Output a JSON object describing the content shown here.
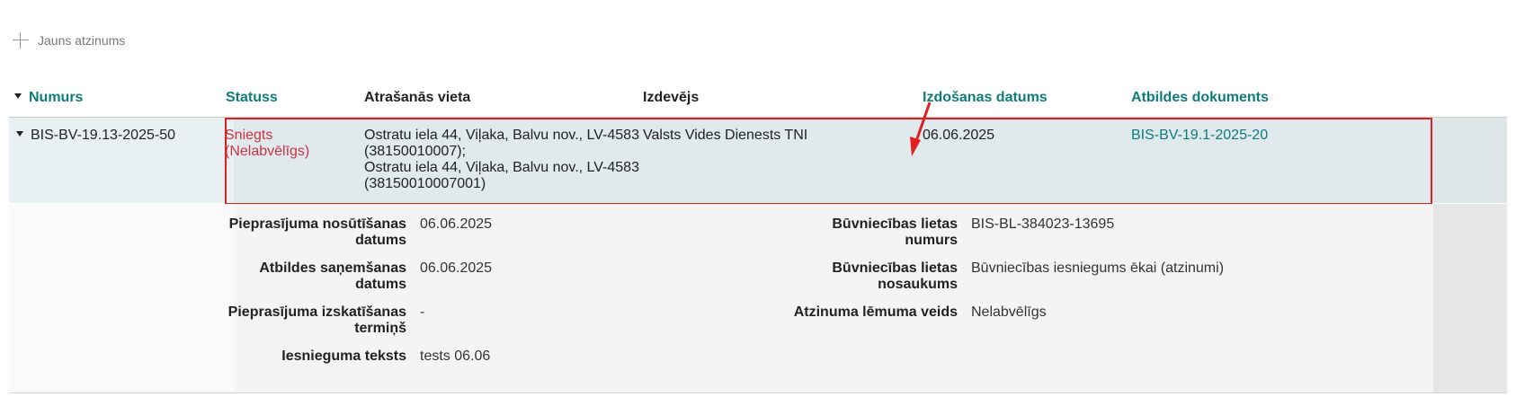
{
  "toolbar": {
    "new_label": "Jauns atzinums"
  },
  "table": {
    "columns": {
      "number": "Numurs",
      "status": "Statuss",
      "location": "Atrašanās vieta",
      "issuer": "Izdevējs",
      "issue_date": "Izdošanas datums",
      "response_doc": "Atbildes dokuments"
    },
    "row": {
      "number": "BIS-BV-19.13-2025-50",
      "status_line1": "Sniegts",
      "status_line2": "(Nelabvēlīgs)",
      "location_lines": [
        "Ostratu iela 44, Viļaka, Balvu nov., LV-4583",
        "(38150010007);",
        "Ostratu iela 44, Viļaka, Balvu nov., LV-4583",
        "(38150010007001)"
      ],
      "issuer": "Valsts Vides Dienests TNI",
      "issue_date": "06.06.2025",
      "response_doc": "BIS-BV-19.1-2025-20"
    }
  },
  "details": {
    "request_sent_label_1": "Pieprasījuma nosūtīšanas",
    "request_sent_label_2": "datums",
    "request_sent_value": "06.06.2025",
    "response_received_label_1": "Atbildes saņemšanas",
    "response_received_label_2": "datums",
    "response_received_value": "06.06.2025",
    "review_deadline_label_1": "Pieprasījuma izskatīšanas",
    "review_deadline_label_2": "termiņš",
    "review_deadline_value": "-",
    "submission_text_label": "Iesnieguma teksts",
    "submission_text_value": "tests 06.06",
    "case_number_label_1": "Būvniecības lietas",
    "case_number_label_2": "numurs",
    "case_number_value": "BIS-BL-384023-13695",
    "case_name_label_1": "Būvniecības lietas",
    "case_name_label_2": "nosaukums",
    "case_name_value": "Būvniecības iesniegums ēkai (atzinumi)",
    "decision_type_label": "Atzinuma lēmuma veids",
    "decision_type_value": "Nelabvēlīgs"
  },
  "colors": {
    "link": "#0e7c7b",
    "status_negative": "#cc3344",
    "highlight": "#e02020"
  }
}
